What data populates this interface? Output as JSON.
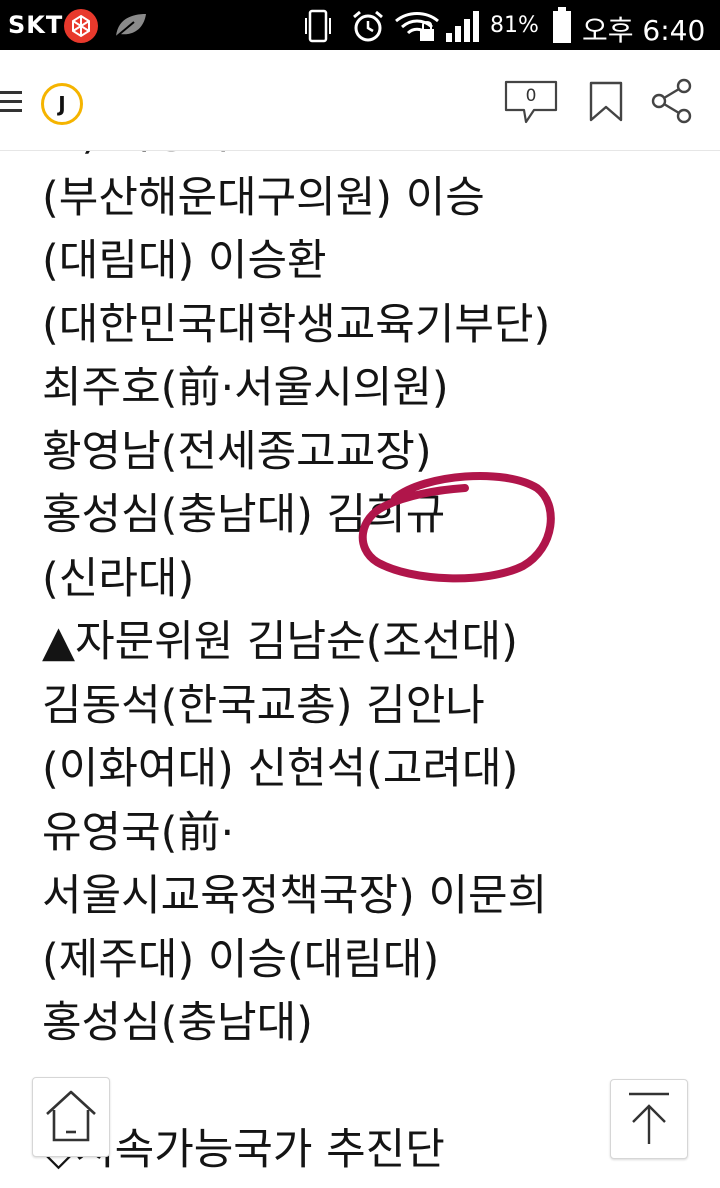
{
  "status_bar": {
    "carrier": "SKT",
    "battery_percent": "81%",
    "time": "오후 6:40",
    "icons": [
      "app-red-icon",
      "leaf-icon",
      "phone-vibrate-icon",
      "alarm-icon",
      "wifi-lock-icon",
      "signal-bars-icon",
      "battery-icon"
    ]
  },
  "header": {
    "logo_letter": "J",
    "comment_count": "0",
    "icons": [
      "menu-icon",
      "comment-icon",
      "bookmark-icon",
      "share-icon"
    ]
  },
  "article": {
    "lines": [
      "교) 이승희",
      "(부산해운대구의원) 이승",
      "(대림대) 이승환",
      "(대한민국대학생교육기부단)",
      "최주호(前·서울시의원)",
      "황영남(전세종고교장)",
      "홍성심(충남대) 김희규",
      "(신라대)",
      "▲자문위원 김남순(조선대)",
      "김동석(한국교총) 김안나",
      "(이화여대) 신현석(고려대)",
      "유영국(前·",
      "서울시교육정책국장) 이문희",
      "(제주대) 이승(대림대)",
      "홍성심(충남대)",
      "",
      "◇지속가능국가 추진단"
    ],
    "marker_color": "#b0154a"
  },
  "floating": {
    "icons": [
      "home-icon",
      "scroll-top-icon"
    ]
  }
}
